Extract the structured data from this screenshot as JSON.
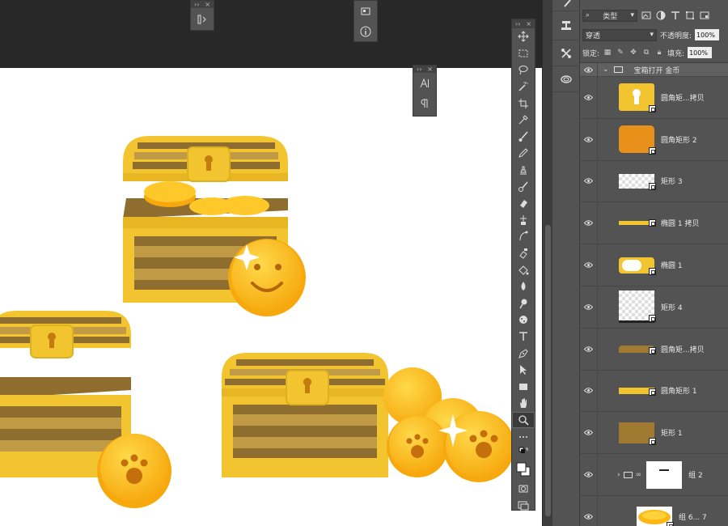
{
  "layers_panel": {
    "filter_kind": "类型",
    "blend_mode": "穿透",
    "opacity_label": "不透明度:",
    "opacity_value": "100%",
    "lock_label": "锁定:",
    "fill_label": "填充:",
    "fill_value": "100%",
    "group_name": "宝箱打开 金币",
    "layers": [
      {
        "name": "圆角矩...拷贝"
      },
      {
        "name": "圆角矩形 2"
      },
      {
        "name": "矩形 3"
      },
      {
        "name": "椭圆 1 拷贝"
      },
      {
        "name": "椭圆 1"
      },
      {
        "name": "矩形 4"
      },
      {
        "name": "圆角矩...拷贝"
      },
      {
        "name": "圆角矩形 1"
      },
      {
        "name": "矩形 1"
      },
      {
        "name": "组 2"
      },
      {
        "name": "组 6... 7"
      }
    ]
  },
  "colors": {
    "chest_gold": "#f2c530",
    "chest_dark": "#ddb020",
    "wood_dark": "#8e6d2e",
    "wood_light": "#c09a45",
    "coin": "#fbb816",
    "coin_light": "#ffd23a",
    "ps_panel": "#535353",
    "ps_dark": "#282828"
  }
}
